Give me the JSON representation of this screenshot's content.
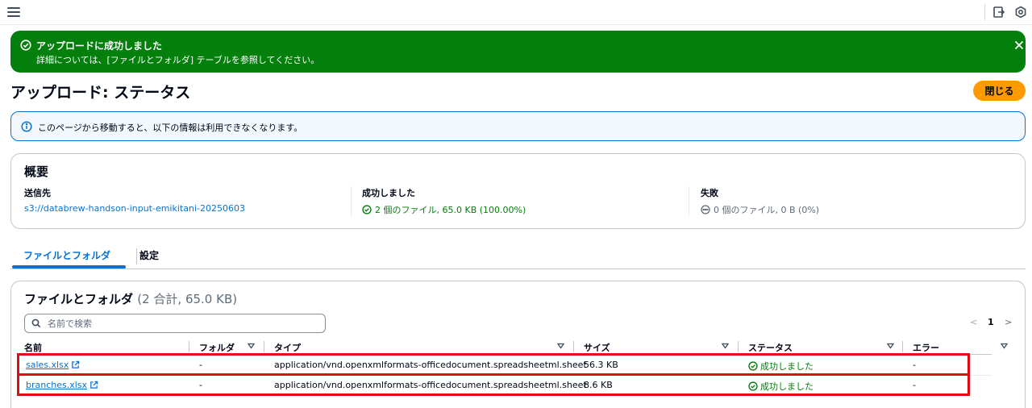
{
  "topbar": {
    "menu_icon": "hamburger-icon",
    "right_icons": [
      "exit-panel-icon",
      "settings-icon"
    ]
  },
  "flash": {
    "title": "アップロードに成功しました",
    "message": "詳細については、[ファイルとフォルダ] テーブルを参照してください。",
    "color": "#037f0c"
  },
  "page": {
    "title": "アップロード: ステータス",
    "close_label": "閉じる"
  },
  "info": {
    "message": "このページから移動すると、以下の情報は利用できなくなります。"
  },
  "summary": {
    "heading": "概要",
    "destination_label": "送信先",
    "destination_value": "s3://databrew-handson-input-emikitani-20250603",
    "succeeded_label": "成功しました",
    "succeeded_value": "2 個のファイル, 65.0 KB (100.00%)",
    "failed_label": "失敗",
    "failed_value": "0 個のファイル, 0 B (0%)"
  },
  "tabs": [
    {
      "label": "ファイルとフォルダ"
    },
    {
      "label": "設定"
    }
  ],
  "files": {
    "heading": "ファイルとフォルダ",
    "count": "(2 合計, 65.0 KB)",
    "search_placeholder": "名前で検索",
    "pagination": {
      "prev": "<",
      "page": "1",
      "next": ">"
    },
    "columns": [
      "名前",
      "フォルダ",
      "タイプ",
      "サイズ",
      "ステータス",
      "エラー"
    ],
    "rows": [
      {
        "name": "sales.xlsx",
        "folder": "-",
        "type": "application/vnd.openxmlformats-officedocument.spreadsheetml.sheet",
        "size": "56.3 KB",
        "status": "成功しました",
        "error": "-"
      },
      {
        "name": "branches.xlsx",
        "folder": "-",
        "type": "application/vnd.openxmlformats-officedocument.spreadsheetml.sheet",
        "size": "8.6 KB",
        "status": "成功しました",
        "error": "-"
      }
    ]
  }
}
